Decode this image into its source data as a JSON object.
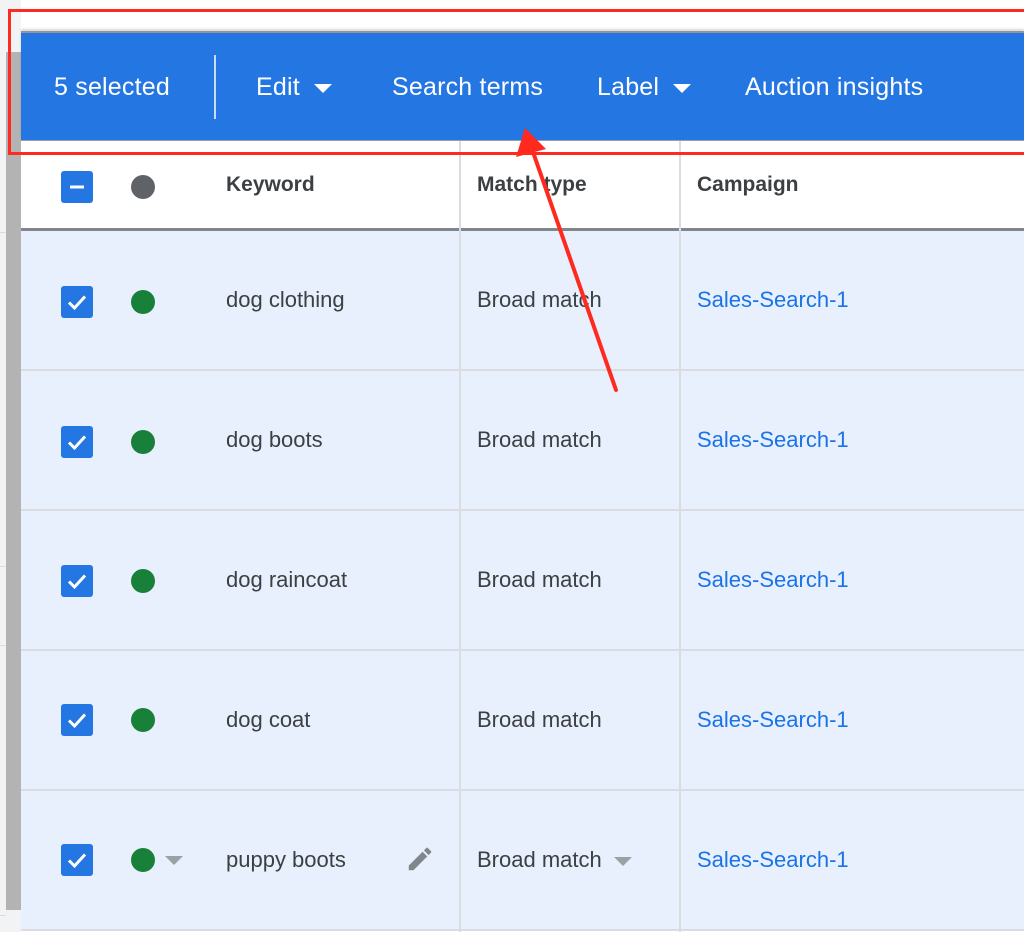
{
  "action_bar": {
    "selected_count_label": "5 selected",
    "edit_label": "Edit",
    "search_terms_label": "Search terms",
    "label_label": "Label",
    "auction_insights_label": "Auction insights",
    "background_color": "#2476e3"
  },
  "table": {
    "header": {
      "select_all_state": "indeterminate",
      "status_icon": "status-dot-gray",
      "columns": [
        "Keyword",
        "Match type",
        "Campaign"
      ]
    },
    "rows": [
      {
        "checked": true,
        "status": "enabled",
        "keyword": "dog clothing",
        "match_type": "Broad match",
        "campaign": "Sales-Search-1"
      },
      {
        "checked": true,
        "status": "enabled",
        "keyword": "dog boots",
        "match_type": "Broad match",
        "campaign": "Sales-Search-1"
      },
      {
        "checked": true,
        "status": "enabled",
        "keyword": "dog raincoat",
        "match_type": "Broad match",
        "campaign": "Sales-Search-1"
      },
      {
        "checked": true,
        "status": "enabled",
        "keyword": "dog coat",
        "match_type": "Broad match",
        "campaign": "Sales-Search-1"
      },
      {
        "checked": true,
        "status": "enabled",
        "keyword": "puppy boots",
        "match_type": "Broad match",
        "campaign": "Sales-Search-1",
        "hovered": true
      }
    ]
  },
  "colors": {
    "status_enabled": "#188038",
    "status_header": "#5f6368",
    "link": "#1a73e8",
    "row_selected_bg": "#e8f0fd",
    "annotation": "#ff2a1f"
  },
  "annotations": {
    "highlight_box": "action-bar",
    "arrow_target": "Search terms"
  }
}
